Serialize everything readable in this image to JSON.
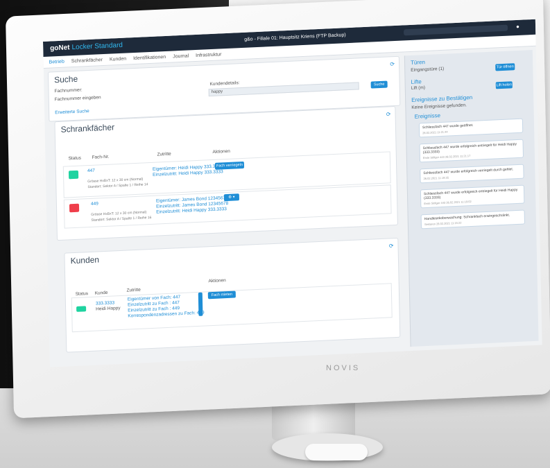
{
  "app": {
    "logo_main": "goNet",
    "logo_sub": "Locker Standard",
    "window_title": "g&o - Filiale 01: Hauptsitz Kriens (FTP Backup)",
    "user_icon": "user-icon"
  },
  "nav": {
    "items": [
      "Betrieb",
      "Schrankfächer",
      "Kunden",
      "Identifikationen",
      "Journal",
      "Infrastruktur"
    ]
  },
  "search": {
    "title": "Suche",
    "fach_label": "Fachnummer:",
    "fach_placeholder": "Fachnummer eingeben",
    "kunde_label": "Kundendetails:",
    "kunde_value": "happy",
    "button": "Suche",
    "advanced": "Erweiterte Suche"
  },
  "lockers": {
    "title": "Schrankfächer",
    "headers": [
      "Status",
      "Fach-Nr.",
      "Zutritte",
      "Aktionen"
    ],
    "rows": [
      {
        "status": "belegt",
        "number": "447",
        "size": "Grösse HxBxT: 12 x 30 cm (Normal)",
        "location": "Standort: Sektor A / Spalte 1 / Reihe 14",
        "access1": "Eigentümer: Heidi Happy 333.3333",
        "access2": "Einzelzutritt: Heidi Happy 333.3333",
        "action": "Fach verriegeln"
      },
      {
        "status": "gesperrt",
        "number": "449",
        "size": "Grösse HxBxT: 12 x 30 cm (Normal)",
        "location": "Standort: Sektor A / Spalte 1 / Reihe 16",
        "access1": "Eigentümer: James Bond 12345678",
        "access2": "Einzelzutritt: James Bond 12345678",
        "access3": "Einzelzutritt: Heidi Happy 333.3333"
      }
    ]
  },
  "customers": {
    "title": "Kunden",
    "headers": [
      "Status",
      "Kunde",
      "Zutritte",
      "Aktionen"
    ],
    "row": {
      "status": "aktiv",
      "number": "333.3333",
      "name": "Heidi Happy",
      "a1": "Eigentümer von Fach: 447",
      "a2": "Einzelzutritt zu Fach : 447",
      "a3": "Einzelzutritt zu Fach : 449",
      "a4": "Korrespondenzadressen zu Fach: 449",
      "action": "Fach mieten"
    }
  },
  "sidebar": {
    "doors_title": "Türen",
    "doors_item": "Eingangstüre (1)",
    "doors_btn": "Tür öffnen",
    "lifts_title": "Lifte",
    "lifts_item": "Lift (m)",
    "lifts_btn": "Lift holen",
    "confirm_title": "Ereignisse zu Bestätigen",
    "confirm_empty": "Keine Ereignisse gefunden.",
    "events_title": "Ereignisse",
    "events": [
      {
        "text": "Schliessfach 447 wurde geöffnet.",
        "date": "26.02.2021 11:21:44"
      },
      {
        "text": "Schliessfach 447 wurde erfolgreich entriegelt für Heidi Happy (333.3333)",
        "date": "Erste Stiftger 443 26.02.2021 11:21:17"
      },
      {
        "text": "Schliessfach 447 wurde erfolgreich verriegelt durch gehlet.",
        "date": "26.02.2021 11:19:35"
      },
      {
        "text": "Schliessfach 447 wurde erfolgreich entriegelt für Heidi Happy (333.3333)",
        "date": "Erste Stiftger 443 26.02.2021 11:19:02"
      },
      {
        "text": "Handlesekoberwachung: Schrankfach erwingeschränkt.",
        "date": "Sektoren 26.02.2021 11:15:22"
      }
    ]
  },
  "monitor": {
    "brand": "NOVIS"
  }
}
